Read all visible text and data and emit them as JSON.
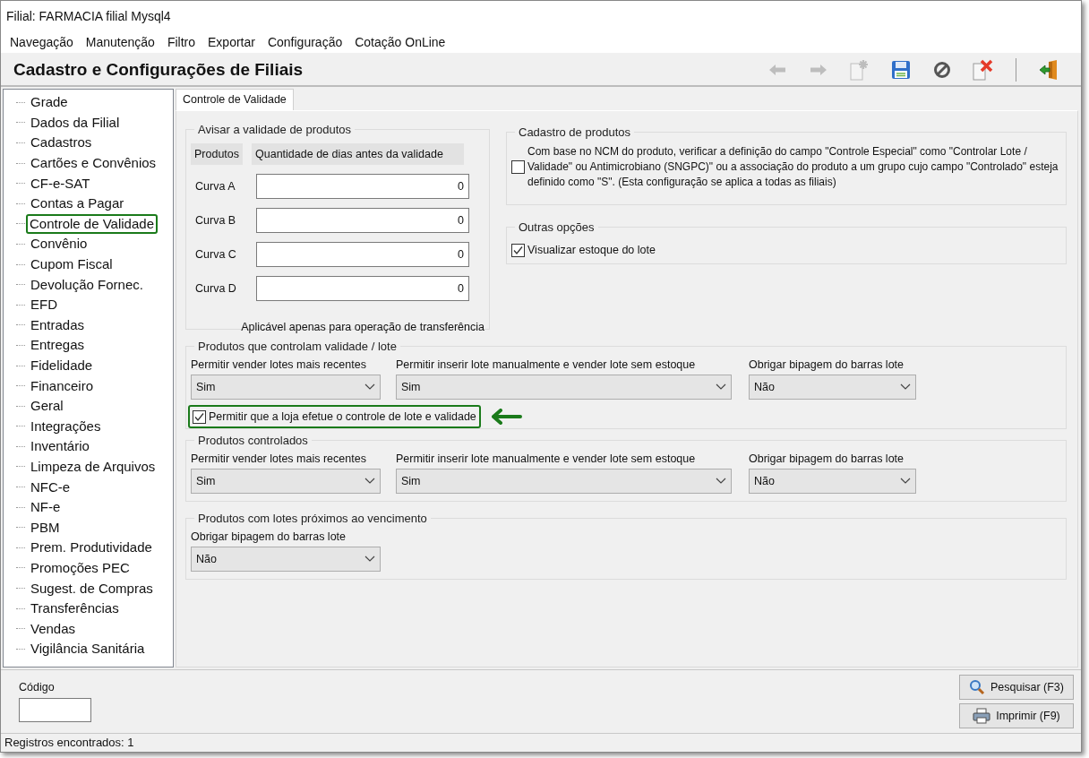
{
  "window": {
    "title": "Filial: FARMACIA filial Mysql4"
  },
  "menu": [
    "Navegação",
    "Manutenção",
    "Filtro",
    "Exportar",
    "Configuração",
    "Cotação OnLine"
  ],
  "header": {
    "title": "Cadastro e Configurações de Filiais"
  },
  "toolbar": [
    {
      "kind": "back",
      "disabled": true
    },
    {
      "kind": "forward",
      "disabled": true
    },
    {
      "kind": "new",
      "disabled": true
    },
    {
      "kind": "save",
      "disabled": false
    },
    {
      "kind": "cancel",
      "disabled": false
    },
    {
      "kind": "delete",
      "disabled": false
    },
    {
      "kind": "exit",
      "disabled": false
    }
  ],
  "sidebar": {
    "items": [
      {
        "label": "Grade",
        "selected": false
      },
      {
        "label": "Dados da Filial",
        "selected": false
      },
      {
        "label": "Cadastros",
        "selected": false
      },
      {
        "label": "Cartões e Convênios",
        "selected": false
      },
      {
        "label": "CF-e-SAT",
        "selected": false
      },
      {
        "label": "Contas a Pagar",
        "selected": false
      },
      {
        "label": "Controle de Validade",
        "selected": true
      },
      {
        "label": "Convênio",
        "selected": false
      },
      {
        "label": "Cupom Fiscal",
        "selected": false
      },
      {
        "label": "Devolução Fornec.",
        "selected": false
      },
      {
        "label": "EFD",
        "selected": false
      },
      {
        "label": "Entradas",
        "selected": false
      },
      {
        "label": "Entregas",
        "selected": false
      },
      {
        "label": "Fidelidade",
        "selected": false
      },
      {
        "label": "Financeiro",
        "selected": false
      },
      {
        "label": "Geral",
        "selected": false
      },
      {
        "label": "Integrações",
        "selected": false
      },
      {
        "label": "Inventário",
        "selected": false
      },
      {
        "label": "Limpeza de Arquivos",
        "selected": false
      },
      {
        "label": "NFC-e",
        "selected": false
      },
      {
        "label": "NF-e",
        "selected": false
      },
      {
        "label": "PBM",
        "selected": false
      },
      {
        "label": "Prem. Produtividade",
        "selected": false
      },
      {
        "label": "Promoções PEC",
        "selected": false
      },
      {
        "label": "Sugest. de Compras",
        "selected": false
      },
      {
        "label": "Transferências",
        "selected": false
      },
      {
        "label": "Vendas",
        "selected": false
      },
      {
        "label": "Vigilância Sanitária",
        "selected": false
      }
    ]
  },
  "tabs": [
    {
      "label": "Controle de Validade",
      "selected": true
    }
  ],
  "validity": {
    "title": "Avisar a validade de produtos",
    "columns": [
      "Produtos",
      "Quantidade de dias antes da validade"
    ],
    "rows": [
      {
        "label": "Curva A",
        "value": "0"
      },
      {
        "label": "Curva B",
        "value": "0"
      },
      {
        "label": "Curva C",
        "value": "0"
      },
      {
        "label": "Curva D",
        "value": "0"
      }
    ],
    "note": "Aplicável apenas para operação de transferência"
  },
  "product_register": {
    "title": "Cadastro de produtos",
    "checked": false,
    "label": "Com base no NCM do produto, verificar a definição do campo \"Controle Especial\" como \"Controlar Lote / Validade\" ou Antimicrobiano (SNGPC)\" ou a associação do produto a um grupo cujo campo \"Controlado\" esteja definido como \"S\". (Esta configuração se aplica a todas as filiais)"
  },
  "other_options": {
    "title": "Outras opções",
    "checked": true,
    "label": "Visualizar estoque do lote"
  },
  "batch_products": {
    "title": "Produtos que controlam validade / lote",
    "selects": [
      {
        "label": "Permitir vender lotes mais recentes",
        "value": "Sim"
      },
      {
        "label": "Permitir inserir lote manualmente e vender lote sem estoque",
        "value": "Sim"
      },
      {
        "label": "Obrigar bipagem do barras lote",
        "value": "Não"
      }
    ],
    "option": {
      "label": "Permitir que a loja efetue o controle de lote e validade",
      "checked": true,
      "highlighted": true
    }
  },
  "controlled_products": {
    "title": "Produtos controlados",
    "selects": [
      {
        "label": "Permitir vender lotes mais recentes",
        "value": "Sim"
      },
      {
        "label": "Permitir inserir lote manualmente e vender lote sem estoque",
        "value": "Sim"
      },
      {
        "label": "Obrigar bipagem do barras lote",
        "value": "Não"
      }
    ]
  },
  "expiring_products": {
    "title": "Produtos com lotes próximos ao vencimento",
    "selects": [
      {
        "label": "Obrigar bipagem do barras lote",
        "value": "Não"
      }
    ]
  },
  "footer": {
    "code_label": "Código",
    "buttons": [
      {
        "kind": "search",
        "label": "Pesquisar (F3)"
      },
      {
        "kind": "print",
        "label": "Imprimir (F9)"
      }
    ]
  },
  "status_bar": "Registros encontrados: 1"
}
